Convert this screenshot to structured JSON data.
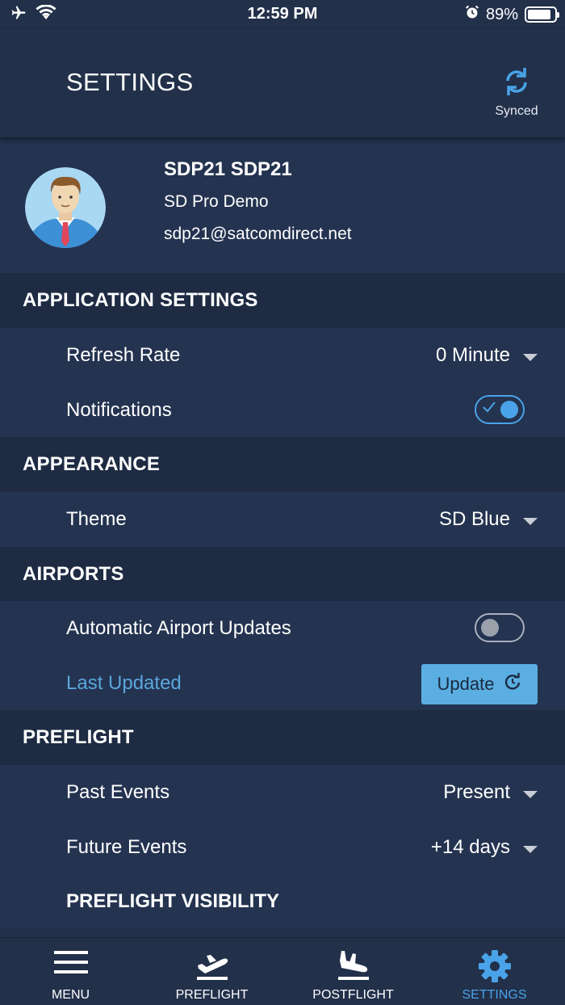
{
  "status_bar": {
    "time": "12:59 PM",
    "battery": "89%",
    "battery_level": 0.89
  },
  "header": {
    "title": "SETTINGS",
    "sync_label": "Synced",
    "sync_icon": "sync-icon"
  },
  "profile": {
    "name": "SDP21 SDP21",
    "organization": "SD Pro Demo",
    "email": "sdp21@satcomdirect.net",
    "avatar_icon": "avatar-icon"
  },
  "sections": {
    "application_settings": "APPLICATION SETTINGS",
    "appearance": "APPEARANCE",
    "airports": "AIRPORTS",
    "preflight": "PREFLIGHT",
    "preflight_visibility": "PREFLIGHT VISIBILITY"
  },
  "settings": {
    "refresh_rate": {
      "label": "Refresh Rate",
      "value": "0 Minute"
    },
    "notifications": {
      "label": "Notifications",
      "enabled": true
    },
    "theme": {
      "label": "Theme",
      "value": "SD Blue"
    },
    "automatic_airport_updates": {
      "label": "Automatic Airport Updates",
      "enabled": false
    },
    "last_updated": {
      "label": "Last Updated",
      "button": "Update"
    },
    "past_events": {
      "label": "Past Events",
      "value": "Present"
    },
    "future_events": {
      "label": "Future Events",
      "value": "+14 days"
    }
  },
  "tabs": [
    {
      "label": "MENU",
      "icon": "menu-icon",
      "active": false
    },
    {
      "label": "PREFLIGHT",
      "icon": "takeoff-icon",
      "active": false
    },
    {
      "label": "POSTFLIGHT",
      "icon": "landing-icon",
      "active": false
    },
    {
      "label": "SETTINGS",
      "icon": "gear-icon",
      "active": true
    }
  ],
  "colors": {
    "background": "#22304a",
    "row": "#243350",
    "section": "#1e2b43",
    "accent": "#4aa3e8",
    "button": "#5aaee2"
  }
}
